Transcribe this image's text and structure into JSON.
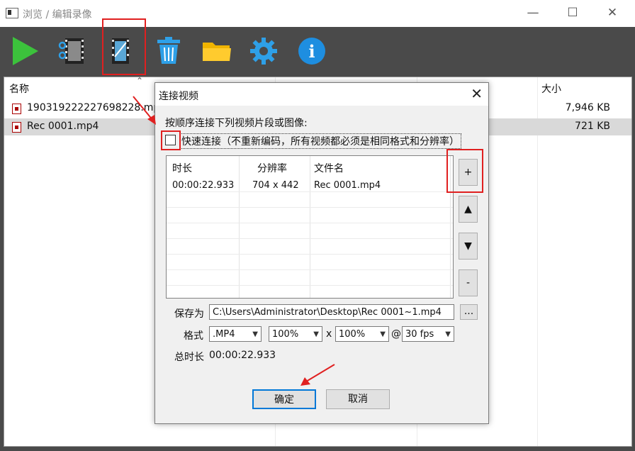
{
  "window": {
    "title": "浏览 / 编辑录像",
    "minimize": "—",
    "maximize": "☐",
    "close": "✕"
  },
  "toolbar": {
    "icons": [
      "play-icon",
      "film-settings-icon",
      "film-edit-icon",
      "trash-icon",
      "folder-icon",
      "gear-icon",
      "info-icon"
    ],
    "info_glyph": "i"
  },
  "filelist": {
    "columns": {
      "name": "名称",
      "size": "大小"
    },
    "rows": [
      {
        "name": "19031922222769822 8.mp4",
        "size": "7,946 KB",
        "display": "190319222227698228.mp"
      },
      {
        "name": "Rec 0001.mp4",
        "size": "721 KB",
        "display": "Rec 0001.mp4"
      }
    ]
  },
  "dialog": {
    "title": "连接视频",
    "close": "✕",
    "instruction": "按顺序连接下列视频片段或图像:",
    "fast_connect_label": "快速连接（不重新编码，所有视频都必须是相同格式和分辨率）",
    "table": {
      "headers": {
        "duration": "时长",
        "resolution": "分辨率",
        "filename": "文件名"
      },
      "rows": [
        {
          "duration": "00:00:22.933",
          "resolution": "704 x 442",
          "filename": "Rec 0001.mp4"
        }
      ]
    },
    "side_buttons": {
      "add": "+",
      "up": "▲",
      "down": "▼",
      "remove": "-"
    },
    "save_as_label": "保存为",
    "save_path": "C:\\Users\\Administrator\\Desktop\\Rec 0001~1.mp4",
    "browse_label": "...",
    "format_label": "格式",
    "format_value": ".MP4",
    "scale_w": "100%",
    "x_sep": "x",
    "scale_h": "100%",
    "at_sep": "@",
    "fps_value": "30 fps",
    "total_label": "总时长",
    "total_value": "00:00:22.933",
    "ok_label": "确定",
    "cancel_label": "取消"
  }
}
